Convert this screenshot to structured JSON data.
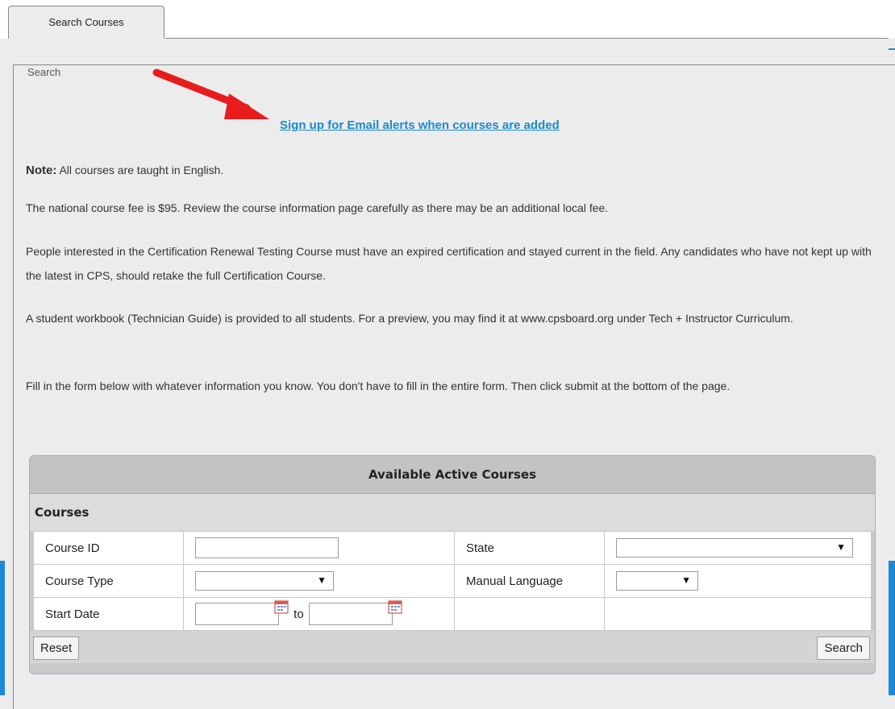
{
  "tabs": [
    {
      "label": "Search Courses"
    }
  ],
  "search": {
    "legend": "Search",
    "email_link": "Sign up for Email alerts when courses are added",
    "note_label": "Note:",
    "note_text": " All courses are taught in English.",
    "para_fee": "The national course fee is $95. Review the course information page carefully as there may be an additional local fee.",
    "para_renewal": "People interested in the Certification Renewal Testing Course must have an expired certification and stayed current in the field. Any candidates who have not kept up with the latest in CPS, should retake the full Certification Course.",
    "para_workbook": "A student workbook (Technician Guide) is provided to all students. For a preview, you may find it at www.cpsboard.org under Tech + Instructor Curriculum.",
    "para_form": "Fill in the form below with whatever information you know. You don't have to fill in the entire form. Then click submit at the bottom of the page."
  },
  "courses_form": {
    "header": "Available Active Courses",
    "subheader": "Courses",
    "course_id_label": "Course ID",
    "course_id_value": "",
    "state_label": "State",
    "state_value": "",
    "course_type_label": "Course Type",
    "course_type_value": "",
    "manual_language_label": "Manual Language",
    "manual_language_value": "",
    "start_date_label": "Start Date",
    "start_date_from": "",
    "to_label": "to",
    "start_date_to": "",
    "reset_label": "Reset",
    "search_label": "Search"
  },
  "colors": {
    "link": "#1a8bd0",
    "arrow": "#e81c1c",
    "accent": "#1e88d8"
  },
  "icons": {
    "calendar": "calendar-icon",
    "dropdown": "chevron-down-icon",
    "annotation": "red-arrow-icon"
  }
}
